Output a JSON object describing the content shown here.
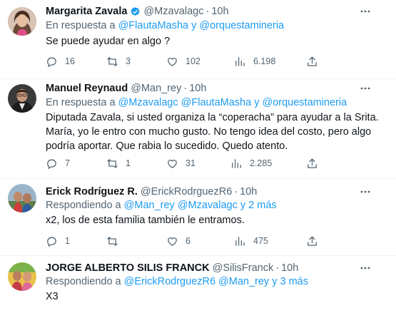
{
  "tweets": [
    {
      "name": "Margarita Zavala",
      "verified": true,
      "handle": "@Mzavalagc",
      "time": "10h",
      "reply_prefix": "En respuesta a ",
      "reply_links": "@FlautaMasha y @orquestamineria",
      "text": "Se puede ayudar en algo ?",
      "replies": "16",
      "retweets": "3",
      "likes": "102",
      "views": "6.198"
    },
    {
      "name": "Manuel Reynaud",
      "verified": false,
      "handle": "@Man_rey",
      "time": "10h",
      "reply_prefix": "En respuesta a ",
      "reply_links": "@Mzavalagc @FlautaMasha y @orquestamineria",
      "text": "Diputada Zavala, si usted organiza la “coperacha” para ayudar a la Srita. María, yo le entro con mucho gusto. No tengo idea del costo, pero algo podría aportar. Que rabia lo sucedido. Quedo atento.",
      "replies": "7",
      "retweets": "1",
      "likes": "31",
      "views": "2.285"
    },
    {
      "name": "Erick Rodríguez R.",
      "verified": false,
      "handle": "@ErickRodrguezR6",
      "time": "10h",
      "reply_prefix": "Respondiendo a ",
      "reply_links": "@Man_rey @Mzavalagc y 2 más",
      "text": "x2, los de esta familia también le entramos.",
      "replies": "1",
      "retweets": "",
      "likes": "6",
      "views": "475"
    },
    {
      "name": "JORGE ALBERTO SILIS FRANCK",
      "verified": false,
      "handle": "@SilisFranck",
      "time": "10h",
      "reply_prefix": "Respondiendo a ",
      "reply_links": "@ErickRodrguezR6 @Man_rey y 3 más",
      "text": "X3"
    }
  ],
  "dot": "·",
  "icons": [
    "verified-badge-icon",
    "more-icon",
    "reply-icon",
    "retweet-icon",
    "like-icon",
    "views-icon",
    "share-icon"
  ],
  "colors": {
    "accent": "#1d9bf0",
    "text": "#0f1419",
    "muted": "#536471",
    "divider": "#eff3f4"
  }
}
